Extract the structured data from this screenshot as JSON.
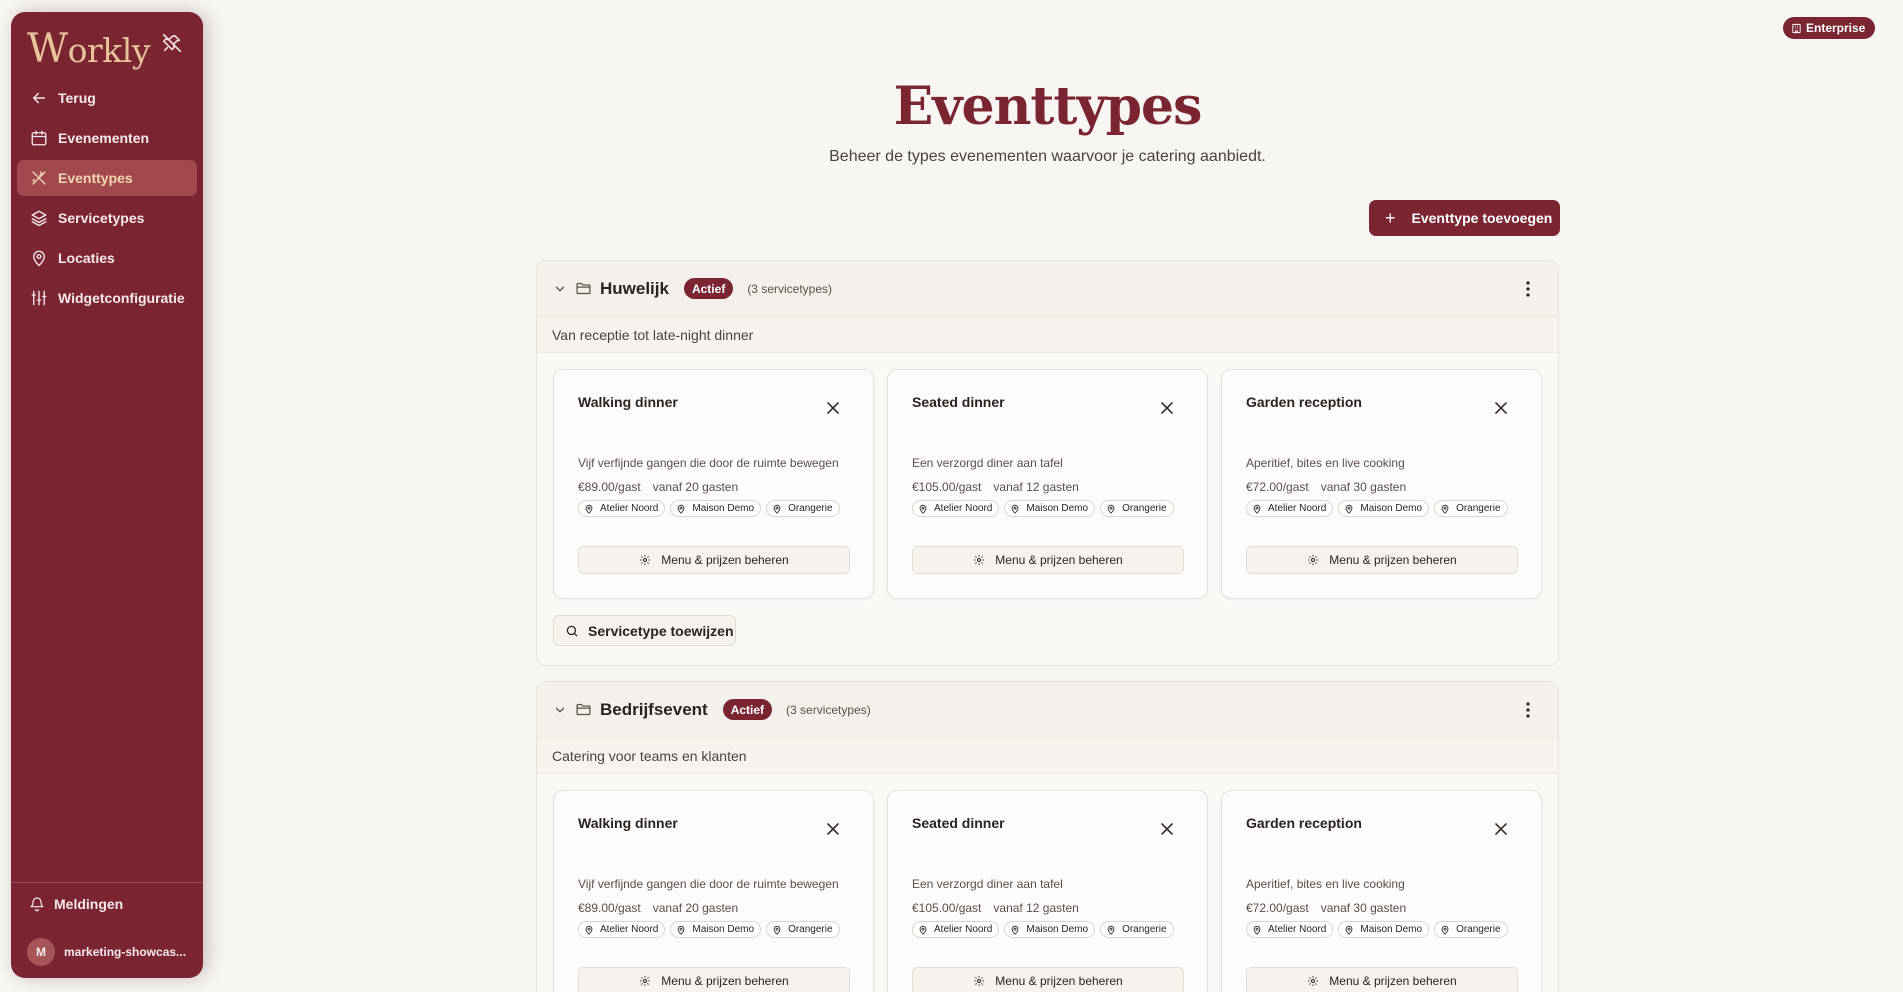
{
  "app": {
    "logo_initial": "W",
    "logo_rest": "orkly"
  },
  "sidebar": {
    "items": [
      {
        "label": "Terug",
        "icon": "arrow-left-icon"
      },
      {
        "label": "Evenementen",
        "icon": "calendar-icon"
      },
      {
        "label": "Eventtypes",
        "icon": "utensils-icon",
        "active": true
      },
      {
        "label": "Servicetypes",
        "icon": "layers-icon"
      },
      {
        "label": "Locaties",
        "icon": "map-pin-icon"
      },
      {
        "label": "Widgetconfiguratie",
        "icon": "sliders-icon"
      }
    ],
    "notifications_label": "Meldingen",
    "user_initial": "M",
    "user_name": "marketing-showcas..."
  },
  "plan_badge": "Enterprise",
  "header": {
    "title": "Eventtypes",
    "subtitle": "Beheer de types evenementen waarvoor je catering aanbiedt.",
    "add_button": "Eventtype toevoegen"
  },
  "groups": [
    {
      "name": "Huwelijk",
      "status": "Actief",
      "count": "(3 servicetypes)",
      "description": "Van receptie tot late-night dinner",
      "assign_label": "Servicetype toewijzen",
      "cards": [
        {
          "title": "Walking dinner",
          "desc": "Vijf verfijnde gangen die door de ruimte bewegen",
          "price": "€89.00/gast",
          "min": "vanaf 20 gasten",
          "locations": [
            "Atelier Noord",
            "Maison Demo",
            "Orangerie"
          ],
          "menu_label": "Menu & prijzen beheren"
        },
        {
          "title": "Seated dinner",
          "desc": "Een verzorgd diner aan tafel",
          "price": "€105.00/gast",
          "min": "vanaf 12 gasten",
          "locations": [
            "Atelier Noord",
            "Maison Demo",
            "Orangerie"
          ],
          "menu_label": "Menu & prijzen beheren"
        },
        {
          "title": "Garden reception",
          "desc": "Aperitief, bites en live cooking",
          "price": "€72.00/gast",
          "min": "vanaf 30 gasten",
          "locations": [
            "Atelier Noord",
            "Maison Demo",
            "Orangerie"
          ],
          "menu_label": "Menu & prijzen beheren"
        }
      ]
    },
    {
      "name": "Bedrijfsevent",
      "status": "Actief",
      "count": "(3 servicetypes)",
      "description": "Catering voor teams en klanten",
      "cards": [
        {
          "title": "Walking dinner",
          "desc": "Vijf verfijnde gangen die door de ruimte bewegen",
          "price": "€89.00/gast",
          "min": "vanaf 20 gasten",
          "locations": [
            "Atelier Noord",
            "Maison Demo",
            "Orangerie"
          ],
          "menu_label": "Menu & prijzen beheren"
        },
        {
          "title": "Seated dinner",
          "desc": "Een verzorgd diner aan tafel",
          "price": "€105.00/gast",
          "min": "vanaf 12 gasten",
          "locations": [
            "Atelier Noord",
            "Maison Demo",
            "Orangerie"
          ],
          "menu_label": "Menu & prijzen beheren"
        },
        {
          "title": "Garden reception",
          "desc": "Aperitief, bites en live cooking",
          "price": "€72.00/gast",
          "min": "vanaf 30 gasten",
          "locations": [
            "Atelier Noord",
            "Maison Demo",
            "Orangerie"
          ],
          "menu_label": "Menu & prijzen beheren"
        }
      ]
    }
  ]
}
